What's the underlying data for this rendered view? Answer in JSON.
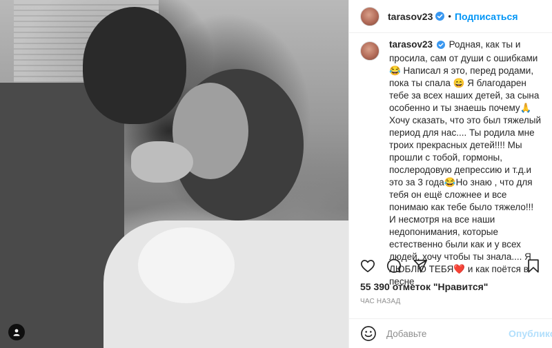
{
  "post": {
    "image_alt": "Black and white photo",
    "author": "tarasov23",
    "follow_label": "Подписаться",
    "separator": "•",
    "caption_user": "tarasov23",
    "caption_text": "Родная, как ты и просила, сам от души с ошибками😂 Написал я это, перед родами, пока ты спала 😄 Я благодарен тебе за всех наших детей, за сына особенно и ты знаешь почему🙏 Хочу сказать, что это был тяжелый период для нас.... Ты родила мне троих прекрасных детей!!!! Мы прошли с тобой, гормоны, послеродовую депрессию и т.д.и это за 3 года😂Но знаю , что для тебя он ещё сложнее и все понимаю как тебе было тяжело!!! И несмотря на все наши недопонимания, которые естественно были как и у всех людей, хочу чтобы ты знала.... Я ЛЮБЛЮ ТЕБЯ❤️ и как поётся в песне",
    "likes": "55 390 отметок \"Нравится\"",
    "time": "ЧАС НАЗАД",
    "comment_placeholder": "Добавьте",
    "publish_label": "Опубликовать"
  },
  "colors": {
    "accent": "#0095f6",
    "publish_disabled": "#b2dffc",
    "verified": "#3897f0",
    "text": "#262626",
    "muted": "#8e8e8e"
  },
  "icons": {
    "verified": "verified-badge-icon",
    "like": "heart-icon",
    "comment": "comment-icon",
    "share": "paper-plane-icon",
    "save": "bookmark-icon",
    "emoji": "smiley-icon",
    "tag": "user-tag-icon"
  }
}
